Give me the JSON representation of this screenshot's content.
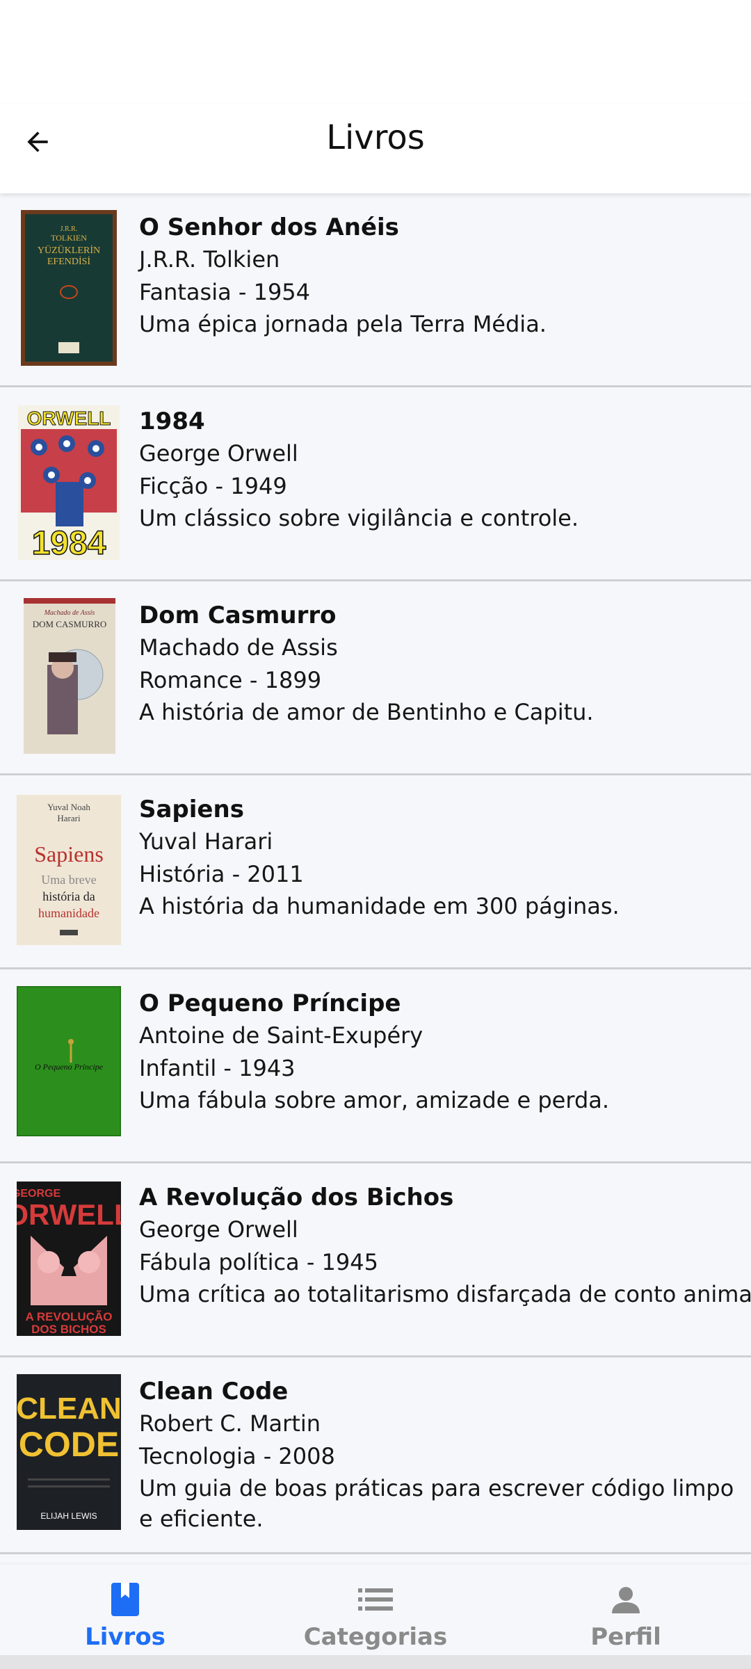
{
  "header": {
    "title": "Livros",
    "back_icon": "arrow-left-icon"
  },
  "books": [
    {
      "title": "O Senhor dos Anéis",
      "author": "J.R.R. Tolkien",
      "genre_year": "Fantasia - 1954",
      "description": "Uma épica jornada pela Terra Média.",
      "cover_text": [
        "J.R.R.",
        "TOLKIEN",
        "YÜZÜKLERİN",
        "EFENDİSİ"
      ]
    },
    {
      "title": "1984",
      "author": "George Orwell",
      "genre_year": "Ficção - 1949",
      "description": "Um clássico sobre vigilância e controle.",
      "cover_text": [
        "ORWELL",
        "1984"
      ]
    },
    {
      "title": "Dom Casmurro",
      "author": "Machado de Assis",
      "genre_year": "Romance - 1899",
      "description": "A história de amor de Bentinho e Capitu.",
      "cover_text": [
        "Machado de Assis",
        "DOM CASMURRO"
      ]
    },
    {
      "title": "Sapiens",
      "author": "Yuval Harari",
      "genre_year": "História - 2011",
      "description": "A história da humanidade em 300 páginas.",
      "cover_text": [
        "Yuval Noah",
        "Harari",
        "Sapiens",
        "Uma breve",
        "história da",
        "humanidade"
      ]
    },
    {
      "title": "O Pequeno Príncipe",
      "author": "Antoine de Saint-Exupéry",
      "genre_year": "Infantil - 1943",
      "description": "Uma fábula sobre amor, amizade e perda.",
      "cover_text": [
        "O Pequeno Príncipe"
      ]
    },
    {
      "title": "A Revolução dos Bichos",
      "author": "George Orwell",
      "genre_year": "Fábula política - 1945",
      "description": "Uma crítica ao totalitarismo disfarçada de conto animal",
      "cover_text": [
        "GEORGE",
        "ORWELL",
        "A REVOLUÇÃO",
        "DOS BICHOS"
      ]
    },
    {
      "title": "Clean Code",
      "author": "Robert C. Martin",
      "genre_year": "Tecnologia - 2008",
      "description": "Um guia de boas práticas para escrever código limpo e eficiente.",
      "cover_text": [
        "CLEAN",
        "CODE",
        "ELIJAH LEWIS"
      ]
    }
  ],
  "nav": [
    {
      "label": "Livros",
      "icon": "book-icon",
      "active": true
    },
    {
      "label": "Categorias",
      "icon": "list-icon",
      "active": false
    },
    {
      "label": "Perfil",
      "icon": "person-icon",
      "active": false
    }
  ],
  "colors": {
    "accent": "#1d6ef5",
    "inactive": "#8a8a8a",
    "background": "#f6f7fa"
  }
}
